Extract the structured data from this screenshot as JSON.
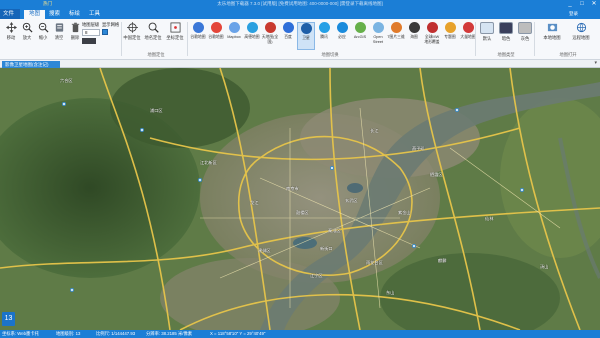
{
  "app": {
    "title": "太乐地图下载器 7.3.0 [试用版] [免费试用地图: 400-0000-000] [需登录下载离线地图]",
    "highlight_tab": "热门",
    "login": "登录",
    "window_controls": [
      "_",
      "□",
      "✕"
    ]
  },
  "tabs": [
    {
      "label": "文件"
    },
    {
      "label": "地图"
    },
    {
      "label": "搜索"
    },
    {
      "label": "标绘"
    },
    {
      "label": "工具"
    }
  ],
  "ribbon": {
    "nav_buttons": [
      {
        "label": "移动",
        "icon": "move-icon"
      },
      {
        "label": "放大",
        "icon": "zoom-in-icon"
      },
      {
        "label": "缩小",
        "icon": "zoom-out-icon"
      },
      {
        "label": "清空",
        "icon": "clear-icon"
      },
      {
        "label": "删除",
        "icon": "delete-icon"
      }
    ],
    "grid_controls": {
      "label_zoom": "地图层级",
      "label_grid": "显示网格",
      "value": "8"
    },
    "locate_buttons": [
      {
        "label": "中国定位",
        "icon": "crosshair-icon"
      },
      {
        "label": "地名定位",
        "icon": "search-icon"
      },
      {
        "label": "坐标定位",
        "icon": "coordinate-icon"
      }
    ],
    "locate_group_label": "地图定位",
    "map_sources": [
      {
        "label": "谷歌地图",
        "color": "#3b78d8"
      },
      {
        "label": "谷歌地图",
        "color": "#e4463a"
      },
      {
        "label": "Mapbox",
        "color": "#6aa3e8"
      },
      {
        "label": "高德地图",
        "color": "#2aa0e0"
      },
      {
        "label": "天地图(全国)",
        "color": "#c93a2f"
      },
      {
        "label": "百度",
        "color": "#2f6fd9"
      },
      {
        "label": "卫星",
        "color": "#1f5fa8"
      },
      {
        "label": "腾讯",
        "color": "#26a0e6"
      },
      {
        "label": "必应",
        "color": "#1a8bdc"
      },
      {
        "label": "ArcGIS",
        "color": "#66b04a"
      },
      {
        "label": "Open Street",
        "color": "#7ab4e2"
      },
      {
        "label": "T图片三维",
        "color": "#e07b2b"
      },
      {
        "label": "海图",
        "color": "#3a3a3a"
      },
      {
        "label": "全球MW地形覆盖",
        "color": "#c03030"
      },
      {
        "label": "专题图",
        "color": "#e7a22b"
      },
      {
        "label": "大量地图",
        "color": "#d23a3a"
      }
    ],
    "source_group_label": "地图切换",
    "overlay_buttons": [
      {
        "label": "默认",
        "color": "#d6e4f2"
      },
      {
        "label": "暗色",
        "color": "#3a3f5c"
      },
      {
        "label": "灰色",
        "color": "#bdbdbd"
      }
    ],
    "overlay_group_label": "地图类型",
    "right_buttons": [
      {
        "label": "本地地图",
        "icon": "local-map-icon"
      },
      {
        "label": "远程地图",
        "icon": "remote-map-icon"
      }
    ],
    "right_group_label": "地图打开"
  },
  "doc_tab": {
    "title": "影像卫星地图(含注记)",
    "pin": "▾"
  },
  "map": {
    "zoom_level": "13",
    "labels": [
      "南京市",
      "江宁区",
      "秦淮区",
      "玄武区",
      "鼓楼区",
      "栖霞区",
      "雨花台区",
      "浦口区",
      "建邺区",
      "六合区",
      "仙林",
      "紫金山",
      "长江",
      "新街口",
      "麒麟",
      "龙江",
      "江北新区",
      "汤山",
      "东山",
      "燕子矶"
    ]
  },
  "status": {
    "coord_sys": "坐标系: Web墨卡托",
    "level": "地图级别: 13",
    "scale": "比例尺: 1/144447.93",
    "resolution": "分辨率: 38.2185 米/像素",
    "lonlat": "X = 118°58'10\"  Y = 29°40'49\""
  }
}
